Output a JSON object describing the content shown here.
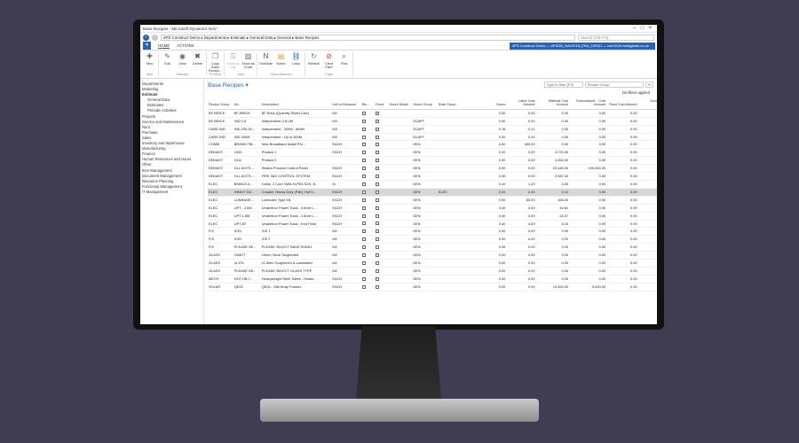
{
  "window": {
    "title": "Base Recipes - Microsoft Dynamics NAV"
  },
  "address": {
    "breadcrumbs": "4PS Construct Demo ▸ Departments ▸ Estimate ▸ General Data ▸ General ▸ Base Recipes",
    "search_placeholder": "Search (Ctrl+F3)"
  },
  "ribbon": {
    "tabs": [
      "HOME",
      "ACTIONS"
    ],
    "company": "4PS Construct Demo — #PSDB_NAV2018_ENU_DEMO — nav2018.metagiants.co.uk",
    "groups": [
      {
        "label": "New",
        "buttons": [
          {
            "label": "New",
            "icon": "new-icon"
          }
        ]
      },
      {
        "label": "Manage",
        "buttons": [
          {
            "label": "Edit",
            "icon": "edit-icon"
          },
          {
            "label": "View",
            "icon": "view-icon"
          },
          {
            "label": "Delete",
            "icon": "delete-icon"
          }
        ]
      },
      {
        "label": "Process",
        "buttons": [
          {
            "label": "Copy Base Recipe...",
            "icon": "copy-icon"
          }
        ]
      },
      {
        "label": "View",
        "buttons": [
          {
            "label": "Show as List",
            "icon": "list-icon"
          },
          {
            "label": "Show as Chart",
            "icon": "chart-icon"
          }
        ]
      },
      {
        "label": "Show Attached",
        "buttons": [
          {
            "label": "OneNote",
            "icon": "onenote-icon"
          },
          {
            "label": "Notes",
            "icon": "notes-icon"
          },
          {
            "label": "Links",
            "icon": "links-icon"
          }
        ]
      },
      {
        "label": "Page",
        "buttons": [
          {
            "label": "Refresh",
            "icon": "refresh-icon"
          },
          {
            "label": "Clear Filter",
            "icon": "clear-filter-icon"
          },
          {
            "label": "Find",
            "icon": "find-icon"
          }
        ]
      }
    ]
  },
  "nav": {
    "items": [
      {
        "label": "Departments",
        "level": 0
      },
      {
        "label": "Marketing",
        "level": 0
      },
      {
        "label": "Estimate",
        "level": 0,
        "open": true
      },
      {
        "label": "General Data",
        "level": 1
      },
      {
        "label": "Estimates",
        "level": 1
      },
      {
        "label": "Periodic Activities",
        "level": 1
      },
      {
        "label": "Projects",
        "level": 0
      },
      {
        "label": "Service and Maintenance",
        "level": 0
      },
      {
        "label": "Rent",
        "level": 0
      },
      {
        "label": "Purchase",
        "level": 0
      },
      {
        "label": "Sales",
        "level": 0
      },
      {
        "label": "Inventory and Warehouse",
        "level": 0
      },
      {
        "label": "Manufacturing",
        "level": 0
      },
      {
        "label": "Finance",
        "level": 0
      },
      {
        "label": "Human Resources and Hours",
        "level": 0
      },
      {
        "label": "Other",
        "level": 0
      },
      {
        "label": "Item Management",
        "level": 0
      },
      {
        "label": "Document Management",
        "level": 0
      },
      {
        "label": "Resource Planning",
        "level": 0
      },
      {
        "label": "Functional Management",
        "level": 0
      },
      {
        "label": "IT Management",
        "level": 0
      }
    ]
  },
  "page": {
    "title": "Base Recipes",
    "filter_placeholder": "Type to filter (F3)",
    "filter_field": "Recipe Group",
    "no_filters": "No filters applied"
  },
  "table": {
    "columns": [
      "Recipe Group",
      "No.",
      "Description",
      "Unit of Measure",
      "Blo...",
      "Fixed",
      "Hours Model",
      "Hours Group",
      "Rate Group",
      "Hours",
      "Labor Cost Amount",
      "Material Cost Amount",
      "Subcontracti... Cost Amount",
      "Plant Cost Amount",
      "Sundry Cost Amount",
      "Cost Am..."
    ],
    "rows": [
      [
        "BF-BRICK",
        "BF-BRICK",
        "BF-Brick (Quantity Sheet Calc)",
        "M2",
        "",
        "",
        "",
        "",
        "",
        "0.00",
        "0.00",
        "0.00",
        "0.00",
        "0.00",
        "0.00",
        ""
      ],
      [
        "BF-BRICK",
        "IND 0-6",
        "Independent 0-6 Life",
        "M3",
        "",
        "",
        "",
        "SCAFF",
        "",
        "0.00",
        "0.00",
        "0.00",
        "0.00",
        "0.00",
        "0.00",
        ""
      ],
      [
        "CARE-IND",
        "IND 200-30...",
        "Independent - 300M - 600M",
        "M3",
        "",
        "",
        "",
        "SCAFF",
        "",
        "0.16",
        "2.12",
        "0.00",
        "0.00",
        "0.00",
        "0.00",
        ""
      ],
      [
        "CARE-IND",
        "IND 300M",
        "Independent - Up to 300M",
        "M3",
        "",
        "",
        "",
        "SCAFF",
        "",
        "0.00",
        "0.00",
        "0.00",
        "0.00",
        "0.00",
        "0.00",
        ""
      ],
      [
        "COMM",
        "BRAND FIB...",
        "New Broadband install P/U",
        "EACH",
        "",
        "",
        "",
        "GEN",
        "",
        "4.00",
        "400.00",
        "0.00",
        "0.00",
        "0.00",
        "0.00",
        ""
      ],
      [
        "DEMAST",
        "1000",
        "Product 1",
        "EACH",
        "",
        "",
        "",
        "GEN",
        "",
        "0.00",
        "0.00",
        "2,270.00",
        "0.00",
        "0.00",
        "0.00",
        ""
      ],
      [
        "DEMAST",
        "1011",
        "Product 2",
        "",
        "",
        "",
        "",
        "GEN",
        "",
        "0.00",
        "0.00",
        "1,000.00",
        "0.00",
        "0.00",
        "0.00",
        ""
      ],
      [
        "DEMAST",
        "GLL1027S-...",
        "Station Process Control Panel",
        "EACH",
        "",
        "",
        "",
        "GEN",
        "",
        "0.00",
        "0.00",
        "25,445.00",
        "100,000.00",
        "0.00",
        "0.00",
        ""
      ],
      [
        "DEMAST",
        "GLL1027S-...",
        "FIRE 3&S CONTROL SYSTEM",
        "EACH",
        "",
        "",
        "",
        "GEN",
        "",
        "0.00",
        "0.00",
        "2,087.00",
        "0.00",
        "0.00",
        "0.00",
        ""
      ],
      [
        "ELEC",
        "BS6519-3...",
        "Cable, 2 Core SWA XLPE/LSZH, B...",
        "M",
        "",
        "",
        "",
        "GEN",
        "",
        "0.10",
        "1.20",
        "3.05",
        "0.00",
        "0.00",
        "0.00",
        ""
      ],
      [
        "ELEC",
        "HEAVY DU...",
        "Coupler, Heavy Duty (Pair), Hot D...",
        "EACH",
        "",
        "",
        "",
        "GEN",
        "ELEC",
        "0.24",
        "2.40",
        "0.12",
        "0.00",
        "0.00",
        "0.00",
        ""
      ],
      [
        "ELEC",
        "LUMINAIR...",
        "Luminaire Type M1",
        "EACH",
        "",
        "",
        "",
        "GEN",
        "",
        "0.00",
        "80.00",
        "155.00",
        "0.00",
        "0.00",
        "0.00",
        ""
      ],
      [
        "ELEC",
        "UPT - 3.6M",
        "Underfloor Power Track - 3.6mtr L...",
        "EACH",
        "",
        "",
        "",
        "GEN",
        "",
        "0.40",
        "4.00",
        "40.61",
        "0.00",
        "0.00",
        "0.00",
        ""
      ],
      [
        "ELEC",
        "UPT-1.8M",
        "Underfloor Power Track - 1.8mtr L...",
        "EACH",
        "",
        "",
        "",
        "GEN",
        "",
        "0.40",
        "4.00",
        "24.07",
        "0.00",
        "0.00",
        "0.00",
        ""
      ],
      [
        "ELEC",
        "UPT-EF",
        "Underfloor Power Track - End Feed",
        "EACH",
        "",
        "",
        "",
        "GEN",
        "",
        "0.40",
        "4.00",
        "6.15",
        "0.00",
        "0.00",
        "0.00",
        ""
      ],
      [
        "FIX",
        "ICE1",
        "ICE 1",
        "M2",
        "",
        "",
        "",
        "GEN",
        "",
        "0.00",
        "0.00",
        "0.00",
        "0.00",
        "0.00",
        "0.00",
        ""
      ],
      [
        "FIX",
        "ICE2",
        "ICE 2",
        "M2",
        "",
        "",
        "",
        "GEN",
        "",
        "0.00",
        "0.00",
        "0.00",
        "0.00",
        "0.00",
        "0.00",
        ""
      ],
      [
        "FIX",
        "PLEASE SE...",
        "PLEASE SELECT BASE RHINO",
        "M2",
        "",
        "",
        "",
        "GEN",
        "",
        "0.00",
        "0.00",
        "0.00",
        "0.00",
        "0.00",
        "0.00",
        ""
      ],
      [
        "GLASS",
        "10MCT",
        "10mm Clear Toughened",
        "M2",
        "",
        "",
        "",
        "GEN",
        "",
        "0.00",
        "0.00",
        "0.00",
        "0.00",
        "0.00",
        "0.00",
        ""
      ],
      [
        "GLASS",
        "11.5TL",
        "11.5mm Toughened & Laminated",
        "M2",
        "",
        "",
        "",
        "GEN",
        "",
        "0.00",
        "0.00",
        "0.00",
        "0.00",
        "0.00",
        "0.00",
        ""
      ],
      [
        "GLASS",
        "PLEASE SE...",
        "PLEASE SELECT GLASS TYPE",
        "M2",
        "",
        "",
        "",
        "GEN",
        "",
        "0.00",
        "0.00",
        "0.00",
        "0.00",
        "0.00",
        "0.00",
        ""
      ],
      [
        "MECH",
        "HOT-HB-7...",
        "Heavyweight Steel Tubes - Hostin...",
        "EACH",
        "",
        "",
        "",
        "GEN",
        "",
        "0.00",
        "0.00",
        "0.00",
        "0.00",
        "0.00",
        "0.00",
        ""
      ],
      [
        "SOLAR",
        "QE02",
        "QE02 - Site Array Frames",
        "EACH",
        "",
        "",
        "",
        "GEN",
        "",
        "0.00",
        "0.00",
        "10,000.00",
        "5,000.00",
        "0.00",
        "0.00",
        ""
      ]
    ],
    "selected_row": 10
  }
}
